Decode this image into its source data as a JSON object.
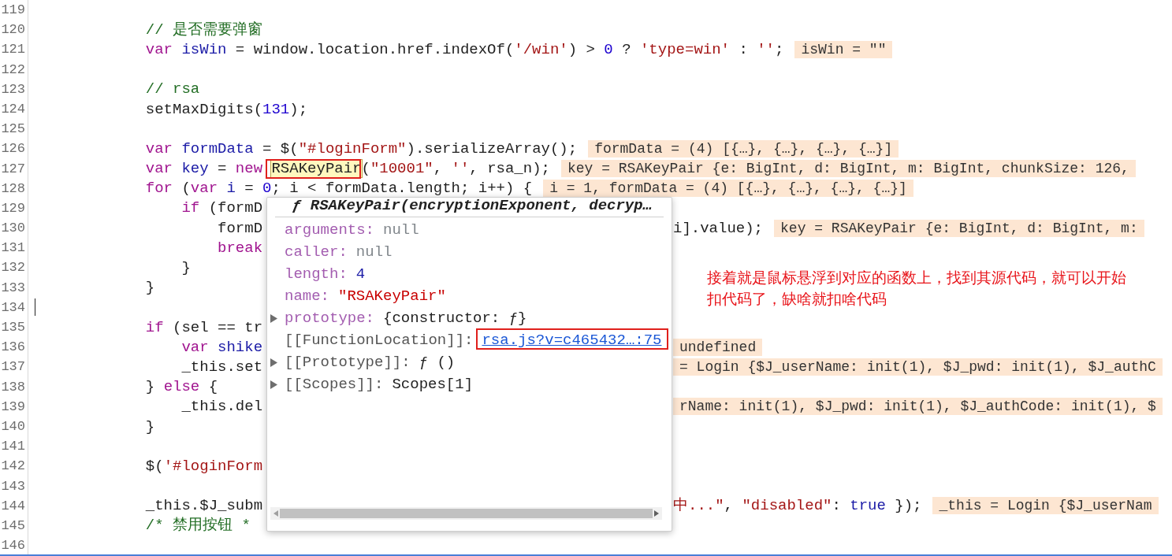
{
  "editor": {
    "lines": [
      {
        "number": "119"
      },
      {
        "number": "120",
        "tokens": [
          {
            "text": "// 是否需要弹窗",
            "kind": "comment"
          }
        ]
      },
      {
        "number": "121",
        "tokens": [
          {
            "text": "var",
            "kind": "keyword"
          },
          {
            "text": " isWin",
            "kind": "def"
          },
          {
            "text": " = window.location.href.indexOf(",
            "kind": "plain"
          },
          {
            "text": "'/win'",
            "kind": "string"
          },
          {
            "text": ") > ",
            "kind": "plain"
          },
          {
            "text": "0",
            "kind": "number"
          },
          {
            "text": " ? ",
            "kind": "plain"
          },
          {
            "text": "'type=win'",
            "kind": "string"
          },
          {
            "text": " : ",
            "kind": "plain"
          },
          {
            "text": "''",
            "kind": "string"
          },
          {
            "text": ";",
            "kind": "plain"
          }
        ],
        "note": "isWin = \"\""
      },
      {
        "number": "122"
      },
      {
        "number": "123",
        "tokens": [
          {
            "text": "// rsa",
            "kind": "comment"
          }
        ]
      },
      {
        "number": "124",
        "tokens": [
          {
            "text": "setMaxDigits(",
            "kind": "plain"
          },
          {
            "text": "131",
            "kind": "number"
          },
          {
            "text": ");",
            "kind": "plain"
          }
        ]
      },
      {
        "number": "125"
      },
      {
        "number": "126",
        "tokens": [
          {
            "text": "var",
            "kind": "keyword"
          },
          {
            "text": " formData",
            "kind": "def"
          },
          {
            "text": " = $(",
            "kind": "plain"
          },
          {
            "text": "\"#loginForm\"",
            "kind": "string"
          },
          {
            "text": ").serializeArray();",
            "kind": "plain"
          }
        ],
        "note": "formData = (4) [{…}, {…}, {…}, {…}]"
      },
      {
        "number": "127",
        "tokens": [
          {
            "text": "var",
            "kind": "keyword"
          },
          {
            "text": " key",
            "kind": "def"
          },
          {
            "text": " = ",
            "kind": "plain"
          },
          {
            "text": "new ",
            "kind": "keyword"
          },
          {
            "text": "RSAKeyPair",
            "kind": "hovered"
          },
          {
            "text": "(",
            "kind": "plain"
          },
          {
            "text": "\"10001\"",
            "kind": "string"
          },
          {
            "text": ", ",
            "kind": "plain"
          },
          {
            "text": "''",
            "kind": "string"
          },
          {
            "text": ", rsa_n);",
            "kind": "plain"
          }
        ],
        "note": "key = RSAKeyPair {e: BigInt, d: BigInt, m: BigInt, chunkSize: 126,"
      },
      {
        "number": "128",
        "tokens": [
          {
            "text": "for",
            "kind": "keyword"
          },
          {
            "text": " (",
            "kind": "plain"
          },
          {
            "text": "var",
            "kind": "keyword"
          },
          {
            "text": " i",
            "kind": "def"
          },
          {
            "text": " = ",
            "kind": "plain"
          },
          {
            "text": "0",
            "kind": "number"
          },
          {
            "text": "; i < formData.length; i++) {",
            "kind": "plain"
          }
        ],
        "note": "i = 1, formData = (4) [{…}, {…}, {…}, {…}]",
        "children": [
          {
            "number": "129",
            "tokens": [
              {
                "text": "if",
                "kind": "keyword"
              },
              {
                "text": " (formD",
                "kind": "plain"
              }
            ],
            "children": [
              {
                "number": "130",
                "tokens": [
                  {
                    "text": "formD",
                    "kind": "plain"
                  }
                ],
                "after": [
                  {
                    "text": "i].value);",
                    "kind": "plain"
                  }
                ],
                "note": "key = RSAKeyPair {e: BigInt, d: BigInt, m:"
              },
              {
                "number": "131",
                "tokens": [
                  {
                    "text": "break",
                    "kind": "keyword"
                  }
                ]
              }
            ]
          },
          {
            "number": "132",
            "tokens": [
              {
                "text": "}",
                "kind": "plain"
              }
            ]
          }
        ]
      },
      {
        "number": "133",
        "tokens": [
          {
            "text": "}",
            "kind": "plain"
          }
        ]
      },
      {
        "number": "134",
        "cursor": true
      },
      {
        "number": "135",
        "tokens": [
          {
            "text": "if",
            "kind": "keyword"
          },
          {
            "text": " (sel == tr",
            "kind": "plain"
          }
        ],
        "children": [
          {
            "number": "136",
            "tokens": [
              {
                "text": "var",
                "kind": "keyword"
              },
              {
                "text": " shike",
                "kind": "def"
              }
            ],
            "hidden_tail": true,
            "note": "undefined"
          },
          {
            "number": "137",
            "tokens": [
              {
                "text": "_this.set",
                "kind": "plain"
              }
            ],
            "hidden_tail": true,
            "note": "= Login {$J_userName: init(1), $J_pwd: init(1), $J_authC"
          }
        ]
      },
      {
        "number": "138",
        "tokens": [
          {
            "text": "} ",
            "kind": "plain"
          },
          {
            "text": "else",
            "kind": "keyword"
          },
          {
            "text": " {",
            "kind": "plain"
          }
        ],
        "children": [
          {
            "number": "139",
            "tokens": [
              {
                "text": "_this.del",
                "kind": "plain"
              }
            ],
            "hidden_tail": true,
            "note": "rName: init(1), $J_pwd: init(1), $J_authCode: init(1), $"
          }
        ]
      },
      {
        "number": "140",
        "tokens": [
          {
            "text": "}",
            "kind": "plain"
          }
        ]
      },
      {
        "number": "141"
      },
      {
        "number": "142",
        "tokens": [
          {
            "text": "$(",
            "kind": "plain"
          },
          {
            "text": "'#loginForm",
            "kind": "string"
          }
        ]
      },
      {
        "number": "143"
      },
      {
        "number": "144",
        "tokens": [
          {
            "text": "_this.$J_subm",
            "kind": "plain"
          }
        ],
        "after": [
          {
            "text": "中...\"",
            "kind": "string"
          },
          {
            "text": ", ",
            "kind": "plain"
          },
          {
            "text": "\"disabled\"",
            "kind": "string"
          },
          {
            "text": ": ",
            "kind": "plain"
          },
          {
            "text": "true",
            "kind": "atom"
          },
          {
            "text": " });",
            "kind": "plain"
          }
        ],
        "note": "_this = Login {$J_userNam"
      },
      {
        "number": "145",
        "tokens": [
          {
            "text": "/* 禁用按钮 *",
            "kind": "comment"
          }
        ]
      },
      {
        "number": "146"
      }
    ]
  },
  "popup": {
    "signature": "ƒ RSAKeyPair(encryptionExponent, decryp…",
    "properties": [
      {
        "key": "arguments:",
        "internal": false,
        "value": "null",
        "kind": "null"
      },
      {
        "key": "caller:",
        "internal": false,
        "value": "null",
        "kind": "null"
      },
      {
        "key": "length:",
        "internal": false,
        "value": "4",
        "kind": "number"
      },
      {
        "key": "name:",
        "internal": false,
        "value": "\"RSAKeyPair\"",
        "kind": "string"
      },
      {
        "key": "prototype:",
        "internal": false,
        "value": "{constructor: ƒ}",
        "kind": "object",
        "expanded": false
      },
      {
        "key": "[[FunctionLocation]]:",
        "internal": true,
        "value": "rsa.js?v=c465432…:75",
        "kind": "link"
      },
      {
        "key": "[[Prototype]]:",
        "internal": true,
        "value": "ƒ ()",
        "kind": "object",
        "expanded": false
      },
      {
        "key": "[[Scopes]]:",
        "internal": true,
        "value": "Scopes[1]",
        "kind": "object",
        "expanded": false
      }
    ]
  },
  "annotation_note": {
    "lines": [
      "接着就是鼠标悬浮到对应的函数上，找到其源代码，就可以开始",
      "扣代码了，缺啥就扣啥代码"
    ]
  }
}
